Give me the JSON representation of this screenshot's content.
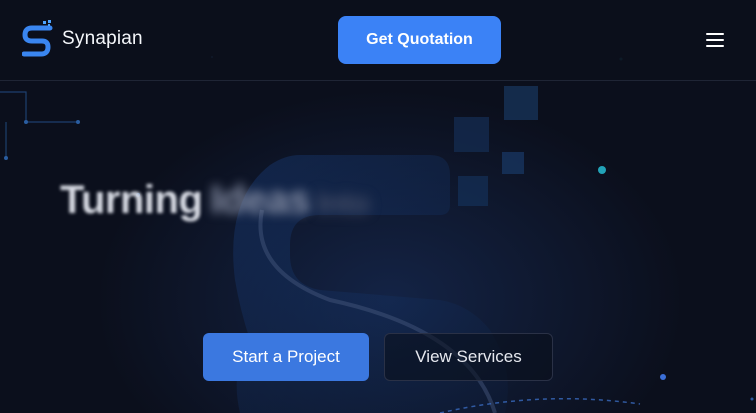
{
  "brand": {
    "name": "Synapian",
    "logo_icon": "synapian-s-logo-icon"
  },
  "header": {
    "cta_label": "Get Quotation",
    "menu_icon": "hamburger-menu-icon"
  },
  "hero": {
    "headline_words": [
      "Turning",
      "Ideas",
      "Into"
    ],
    "primary_cta": "Start a Project",
    "secondary_cta": "View Services"
  },
  "colors": {
    "background": "#0b0f1c",
    "accent": "#3b82f6",
    "primary_button": "#3b78e0",
    "teal_dot": "#22a3b8"
  }
}
